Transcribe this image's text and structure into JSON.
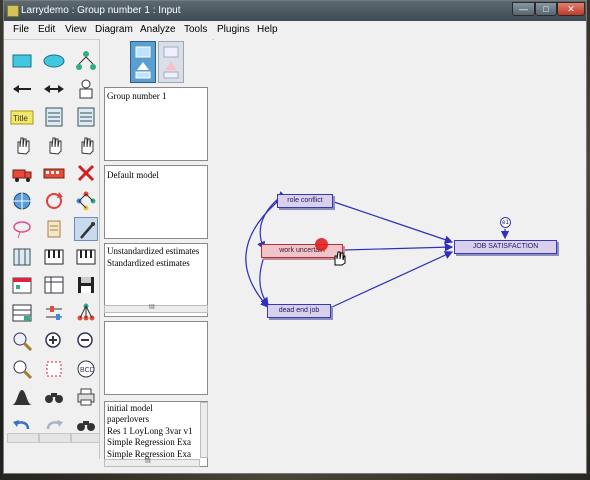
{
  "window": {
    "title": "Larrydemo : Group number 1 : Input"
  },
  "menubar": [
    "File",
    "Edit",
    "View",
    "Diagram",
    "Analyze",
    "Tools",
    "Plugins",
    "Help"
  ],
  "toolbox": {
    "col1": [
      "rectangle-icon",
      "arrow-left-icon",
      "title-icon",
      "hand-icon",
      "truck-icon",
      "move-icon",
      "lasso-icon",
      "grid-icon",
      "calendar-icon",
      "table-icon",
      "zoom-icon",
      "magnify-icon",
      "bell-curve-icon",
      "undo-icon"
    ],
    "col2": [
      "ellipse-icon",
      "double-arrow-icon",
      "list-icon",
      "hand-icon",
      "bus-icon",
      "rotate-icon",
      "scroll-icon",
      "piano-icon",
      "table-icon",
      "sliders-icon",
      "zoom-in-icon",
      "fit-page-icon",
      "binoculars-icon",
      "redo-icon"
    ],
    "col3": [
      "indicator-icon",
      "person-icon",
      "list-icon",
      "hand-icon",
      "delete-icon",
      "tree-icon",
      "brush-icon",
      "piano-icon",
      "save-icon",
      "tree-icon",
      "zoom-out-icon",
      "fit-page-icon",
      "printer-icon",
      "binoculars-icon"
    ]
  },
  "panels": {
    "group": {
      "label": "Group number 1"
    },
    "model": {
      "label": "Default model"
    },
    "estimates": {
      "items": [
        "Unstandardized estimates",
        "Standardized estimates"
      ],
      "hscroll": "III"
    },
    "files": {
      "items": [
        "initial model",
        "paperlovers",
        "Res 1 LoyLong 3var v1",
        "Simple Regression Exa",
        "Simple Regression Exa"
      ],
      "hscroll": "III"
    }
  },
  "diagram": {
    "nodes": {
      "role_conflict": "role conflict",
      "work_uncertainty": "work uncertain",
      "dead_end_job": "dead end job",
      "job_satisfaction": "JOB SATISFACTION",
      "error": "e1"
    },
    "colors": {
      "node_fill": "#d9d0ee",
      "node_border": "#3838b0",
      "selected_fill": "#f0c4c8",
      "arrow": "#3030c0"
    }
  }
}
